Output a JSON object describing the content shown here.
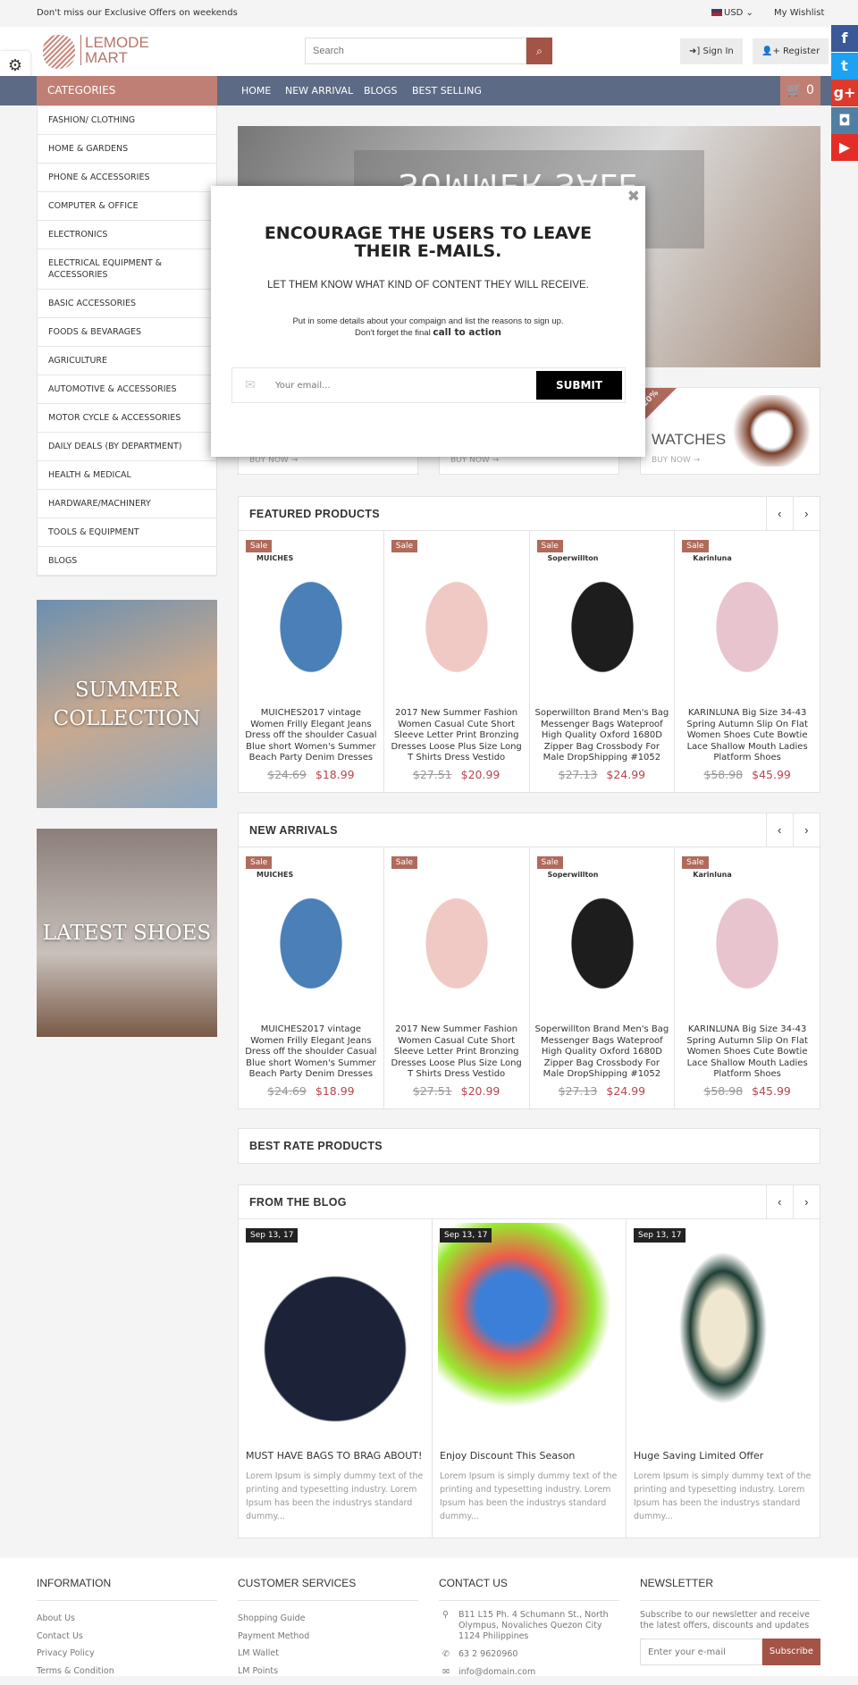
{
  "topbar": {
    "promo": "Don't miss our Exclusive Offers on weekends",
    "currency": "USD",
    "wishlist": "My Wishlist"
  },
  "header": {
    "logo": "LEMODE MART",
    "logo_line1": "LEMODE",
    "logo_line2": "MART",
    "search_placeholder": "Search",
    "sign_in": "Sign In",
    "register": "Register"
  },
  "nav": {
    "categories": "CATEGORIES",
    "items": [
      "HOME",
      "NEW ARRIVAL",
      "BLOGS",
      "BEST SELLING"
    ],
    "cart_count": "0"
  },
  "social": [
    {
      "icon": "facebook-icon",
      "glyph": "f",
      "color": "#3b5998"
    },
    {
      "icon": "twitter-icon",
      "glyph": "t",
      "color": "#1da1f2"
    },
    {
      "icon": "google-plus-icon",
      "glyph": "g+",
      "color": "#dd3a2b"
    },
    {
      "icon": "instagram-icon",
      "glyph": "◘",
      "color": "#517fa4"
    },
    {
      "icon": "youtube-icon",
      "glyph": "▶",
      "color": "#e52d27"
    }
  ],
  "categories": [
    "FASHION/ CLOTHING",
    "HOME & GARDENS",
    "PHONE & ACCESSORIES",
    "COMPUTER & OFFICE",
    "ELECTRONICS",
    "ELECTRICAL EQUIPMENT & ACCESSORIES",
    "BASIC ACCESSORIES",
    "FOODS & BEVARAGES",
    "AGRICULTURE",
    "AUTOMOTIVE & ACCESSORIES",
    "MOTOR CYCLE & ACCESSORIES",
    "DAILY DEALS (BY DEPARTMENT)",
    "HEALTH & MEDICAL",
    "HARDWARE/MACHINERY",
    "TOOLS & EQUIPMENT",
    "BLOGS"
  ],
  "side_banners": [
    "SUMMER COLLECTION",
    "LATEST SHOES"
  ],
  "hero": {
    "text": "SUMMER SALE"
  },
  "banners": [
    {
      "title": "",
      "cta": "BUY NOW →"
    },
    {
      "title": "",
      "cta": "BUY NOW →"
    },
    {
      "title": "WATCHES",
      "cta": "BUY NOW →",
      "badge": "20%"
    }
  ],
  "sale_label": "Sale",
  "products": [
    {
      "brand": "MUICHES",
      "name": "MUICHES2017 vintage Women Frilly Elegant Jeans Dress off the shoulder Casual Blue short Women's Summer Beach Party Denim Dresses",
      "old_price": "$24.69",
      "price": "$18.99"
    },
    {
      "brand": "",
      "name": "2017 New Summer Fashion Women Casual Cute Short Sleeve Letter Print Bronzing Dresses Loose Plus Size Long T Shirts Dress Vestido",
      "old_price": "$27.51",
      "price": "$20.99"
    },
    {
      "brand": "Soperwillton",
      "name": "Soperwillton Brand Men's Bag Messenger Bags Wateproof High Quality Oxford 1680D Zipper Bag Crossbody For Male DropShipping #1052",
      "old_price": "$27.13",
      "price": "$24.99"
    },
    {
      "brand": "Karinluna",
      "name": "KARINLUNA Big Size 34-43 Spring Autumn Slip On Flat Women Shoes Cute Bowtie Lace Shallow Mouth Ladies Platform Shoes",
      "old_price": "$58.98",
      "price": "$45.99"
    }
  ],
  "sections": {
    "featured": "FEATURED PRODUCTS",
    "new_arrivals": "NEW ARRIVALS",
    "best_rate": "BEST RATE PRODUCTS",
    "blog": "FROM THE BLOG"
  },
  "blog": [
    {
      "date": "Sep 13, 17",
      "title": "MUST HAVE BAGS TO BRAG ABOUT!",
      "desc": "Lorem Ipsum is simply dummy text of the printing and typesetting industry. Lorem Ipsum has been the industrys standard dummy..."
    },
    {
      "date": "Sep 13, 17",
      "title": "Enjoy Discount This Season",
      "desc": "Lorem Ipsum is simply dummy text of the printing and typesetting industry. Lorem Ipsum has been the industrys standard dummy..."
    },
    {
      "date": "Sep 13, 17",
      "title": "Huge Saving Limited Offer",
      "desc": "Lorem Ipsum is simply dummy text of the printing and typesetting industry. Lorem Ipsum has been the industrys standard dummy..."
    }
  ],
  "footer": {
    "information": {
      "title": "INFORMATION",
      "links": [
        "About Us",
        "Contact Us",
        "Privacy Policy",
        "Terms & Condition"
      ]
    },
    "customer": {
      "title": "CUSTOMER SERVICES",
      "links": [
        "Shopping Guide",
        "Payment Method",
        "LM Wallet",
        "LM Points"
      ]
    },
    "contact": {
      "title": "CONTACT US",
      "address": "B11 L15 Ph. 4 Schumann St., North Olympus, Novaliches Quezon City 1124 Philippines",
      "phone": "63 2 9620960",
      "email": "info@domain.com"
    },
    "newsletter": {
      "title": "NEWSLETTER",
      "text": "Subscribe to our newsletter and receive the latest offers, discounts and updates",
      "placeholder": "Enter your e-mail",
      "button": "Subscribe"
    }
  },
  "popup": {
    "title": "ENCOURAGE THE USERS TO LEAVE THEIR E-MAILS.",
    "subtitle": "LET THEM KNOW WHAT KIND OF CONTENT THEY WILL RECEIVE.",
    "details": "Put in some details about your compaign and list the reasons to sign up.",
    "details2": "Don't forget the final",
    "cta_text": "call to action",
    "email_placeholder": "Your email...",
    "submit": "SUBMIT"
  },
  "colors": {
    "accent": "#c07f74",
    "nav": "#5d6a85",
    "price": "#b9464d",
    "button_dark": "#a35446"
  }
}
